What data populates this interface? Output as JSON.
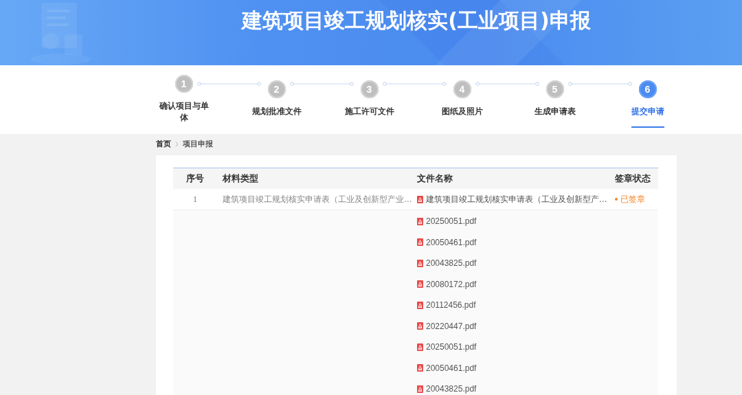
{
  "banner": {
    "title": "建筑项目竣工规划核实(工业项目)申报"
  },
  "steps": [
    {
      "number": "1",
      "label": "确认项目与单体",
      "selected": false
    },
    {
      "number": "2",
      "label": "规划批准文件",
      "selected": false
    },
    {
      "number": "3",
      "label": "施工许可文件",
      "selected": false
    },
    {
      "number": "4",
      "label": "图纸及照片",
      "selected": false
    },
    {
      "number": "5",
      "label": "生成申请表",
      "selected": false
    },
    {
      "number": "6",
      "label": "提交申请",
      "selected": true
    }
  ],
  "breadcrumb": [
    "首页",
    "项目申报"
  ],
  "table": {
    "columns": [
      "序号",
      "材料类型",
      "文件名称",
      "签章状态"
    ],
    "rows": [
      {
        "index": "1",
        "material_type": "建筑项目竣工规划核实申请表（工业及创新型产业…",
        "files": [
          "建筑项目竣工规划核实申请表（工业及创新型产…"
        ],
        "status": {
          "label": "已签章",
          "color": "#f5821f"
        }
      },
      {
        "files": [
          "20250051.pdf",
          "20050461.pdf",
          "20043825.pdf",
          "20080172.pdf",
          "20112456.pdf",
          "20220447.pdf",
          "20250051.pdf",
          "20050461.pdf",
          "20043825.pdf"
        ]
      }
    ]
  }
}
